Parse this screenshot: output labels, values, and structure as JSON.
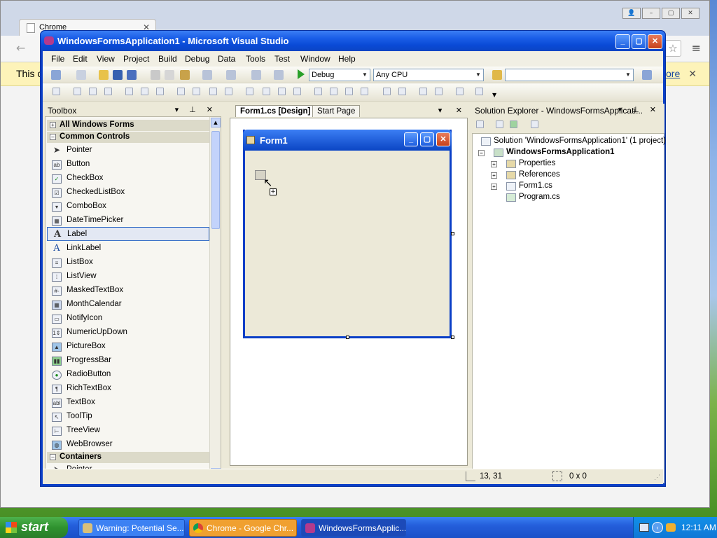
{
  "chrome": {
    "tab_label": "Chrome",
    "tab_close": "✕",
    "back_glyph": "←",
    "star_glyph": "☆",
    "menu_glyph": "≡",
    "infobar_text": "This c",
    "infobar_link": "ore",
    "infobar_close": "✕",
    "window_buttons": [
      "👤",
      "–",
      "▢",
      "✕"
    ]
  },
  "vs": {
    "title": "WindowsFormsApplication1 - Microsoft Visual Studio",
    "menu": [
      "File",
      "Edit",
      "View",
      "Project",
      "Build",
      "Debug",
      "Data",
      "Tools",
      "Test",
      "Window",
      "Help"
    ],
    "config_combo": "Debug",
    "platform_combo": "Any CPU",
    "search_combo": ""
  },
  "toolbox": {
    "title": "Toolbox",
    "groups": [
      "All Windows Forms",
      "Common Controls",
      "Containers"
    ],
    "items": [
      "Pointer",
      "Button",
      "CheckBox",
      "CheckedListBox",
      "ComboBox",
      "DateTimePicker",
      "Label",
      "LinkLabel",
      "ListBox",
      "ListView",
      "MaskedTextBox",
      "MonthCalendar",
      "NotifyIcon",
      "NumericUpDown",
      "PictureBox",
      "ProgressBar",
      "RadioButton",
      "RichTextBox",
      "TextBox",
      "ToolTip",
      "TreeView",
      "WebBrowser"
    ],
    "container_items": [
      "Pointer"
    ],
    "selected": "Label"
  },
  "designer": {
    "tabs": [
      "Form1.cs [Design]",
      "Start Page"
    ],
    "form_title": "Form1"
  },
  "solution_explorer": {
    "title": "Solution Explorer - WindowsFormsApplicati...",
    "solution": "Solution 'WindowsFormsApplication1' (1 project)",
    "project": "WindowsFormsApplication1",
    "nodes": [
      "Properties",
      "References",
      "Form1.cs",
      "Program.cs"
    ]
  },
  "status": {
    "position": "13, 31",
    "size": "0 x 0"
  },
  "taskbar": {
    "start": "start",
    "tasks": [
      "Warning: Potential Se...",
      "Chrome - Google Chr...",
      "WindowsFormsApplic..."
    ],
    "clock": "12:11 AM"
  }
}
